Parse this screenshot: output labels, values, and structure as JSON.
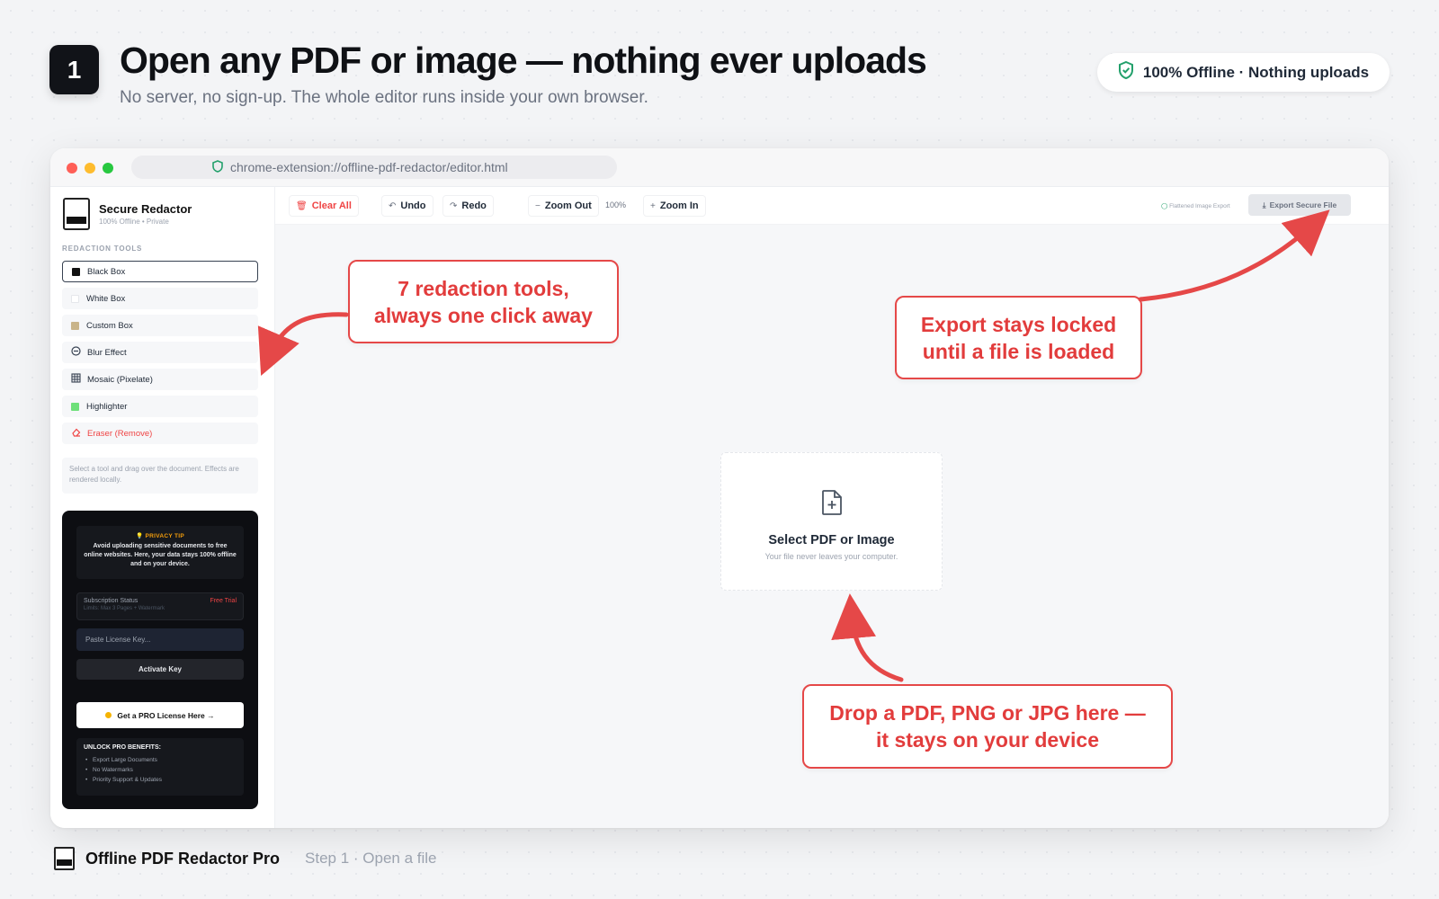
{
  "header": {
    "step_number": "1",
    "title": "Open any PDF or image — nothing ever uploads",
    "subtitle": "No server, no sign-up. The whole editor runs inside your own browser.",
    "offline_badge": "100% Offline · Nothing uploads"
  },
  "browser": {
    "url": "chrome-extension://offline-pdf-redactor/editor.html"
  },
  "sidebar": {
    "brand_name": "Secure Redactor",
    "brand_sub": "100% Offline • Private",
    "section_label": "REDACTION TOOLS",
    "tools": [
      {
        "label": "Black Box",
        "icon": "black-swatch",
        "color": "#111111"
      },
      {
        "label": "White Box",
        "icon": "white-swatch",
        "color": "#ffffff"
      },
      {
        "label": "Custom Box",
        "icon": "custom-swatch",
        "color": "#c9b48a"
      },
      {
        "label": "Blur Effect",
        "icon": "blur-icon"
      },
      {
        "label": "Mosaic (Pixelate)",
        "icon": "grid-icon"
      },
      {
        "label": "Highlighter",
        "icon": "highlight-swatch",
        "color": "#6ee07a"
      },
      {
        "label": "Eraser (Remove)",
        "icon": "eraser-icon"
      }
    ],
    "hint": "Select a tool and drag over the document. Effects are rendered locally.",
    "privacy_tip_title": "PRIVACY TIP",
    "privacy_tip_text": "Avoid uploading sensitive documents to free online websites. Here, your data stays 100% offline and on your device.",
    "subscription_label": "Subscription Status",
    "subscription_value": "Free Trial",
    "subscription_limits": "Limits: Max 3 Pages + Watermark",
    "license_placeholder": "Paste License Key...",
    "activate_label": "Activate Key",
    "pro_label": "Get a PRO License Here →",
    "benefits_title": "UNLOCK PRO BENEFITS:",
    "benefits": [
      "Export Large Documents",
      "No Watermarks",
      "Priority Support & Updates"
    ]
  },
  "toolbar": {
    "clear_all": "Clear All",
    "undo": "Undo",
    "redo": "Redo",
    "zoom_out": "Zoom Out",
    "zoom_level": "100%",
    "zoom_in": "Zoom In",
    "flattened_label": "Flattened Image Export",
    "export_label": "Export Secure File"
  },
  "canvas": {
    "drop_title": "Select PDF or Image",
    "drop_sub": "Your file never leaves your computer."
  },
  "callouts": {
    "tools": [
      "7 redaction tools,",
      "always one click away"
    ],
    "export": [
      "Export stays locked",
      "until a file is loaded"
    ],
    "drop": [
      "Drop a PDF, PNG or JPG here —",
      "it stays on your device"
    ]
  },
  "footer": {
    "app_name": "Offline PDF Redactor Pro",
    "step_label": "Step 1 · Open a file"
  },
  "colors": {
    "accent_red": "#e54848",
    "shield_green": "#22a06b"
  }
}
